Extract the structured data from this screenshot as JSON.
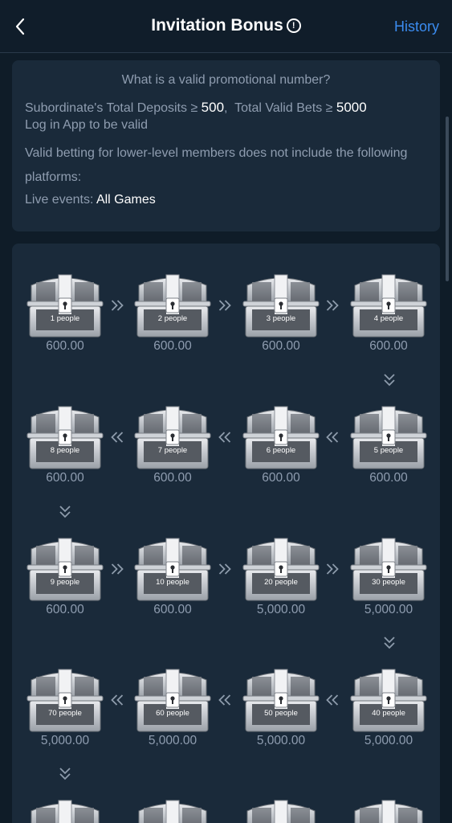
{
  "header": {
    "title": "Invitation Bonus",
    "info_glyph": "!",
    "history_label": "History"
  },
  "info": {
    "question": "What is a valid promotional number?",
    "req_deposit_label": "Subordinate's Total Deposits ≥",
    "req_deposit_value": "500",
    "req_sep": ",",
    "req_bet_label": "Total Valid Bets ≥",
    "req_bet_value": "5000",
    "req_login": "Log in App to be valid",
    "valid_text": "Valid betting for lower-level members does not include the following platforms:",
    "live_label": "Live events:",
    "live_value": "All Games"
  },
  "chests": [
    {
      "label": "1 people",
      "amount": "600.00"
    },
    {
      "label": "2 people",
      "amount": "600.00"
    },
    {
      "label": "3 people",
      "amount": "600.00"
    },
    {
      "label": "4 people",
      "amount": "600.00"
    },
    {
      "label": "5 people",
      "amount": "600.00"
    },
    {
      "label": "6 people",
      "amount": "600.00"
    },
    {
      "label": "7 people",
      "amount": "600.00"
    },
    {
      "label": "8 people",
      "amount": "600.00"
    },
    {
      "label": "9 people",
      "amount": "600.00"
    },
    {
      "label": "10 people",
      "amount": "600.00"
    },
    {
      "label": "20 people",
      "amount": "5,000.00"
    },
    {
      "label": "30 people",
      "amount": "5,000.00"
    },
    {
      "label": "40 people",
      "amount": "5,000.00"
    },
    {
      "label": "50 people",
      "amount": "5,000.00"
    },
    {
      "label": "60 people",
      "amount": "5,000.00"
    },
    {
      "label": "70 people",
      "amount": "5,000.00"
    }
  ],
  "icons": {
    "back": "chevron-left-icon",
    "info": "info-icon",
    "chest": "treasure-chest-icon",
    "arrow_right": "double-chevron-right-icon",
    "arrow_left": "double-chevron-left-icon",
    "arrow_down": "double-chevron-down-icon"
  },
  "colors": {
    "background": "#0f1c28",
    "card": "#1a2a3a",
    "accent": "#3b8cf0",
    "text_muted": "#8f9db0",
    "text_bright": "#ffffff"
  }
}
